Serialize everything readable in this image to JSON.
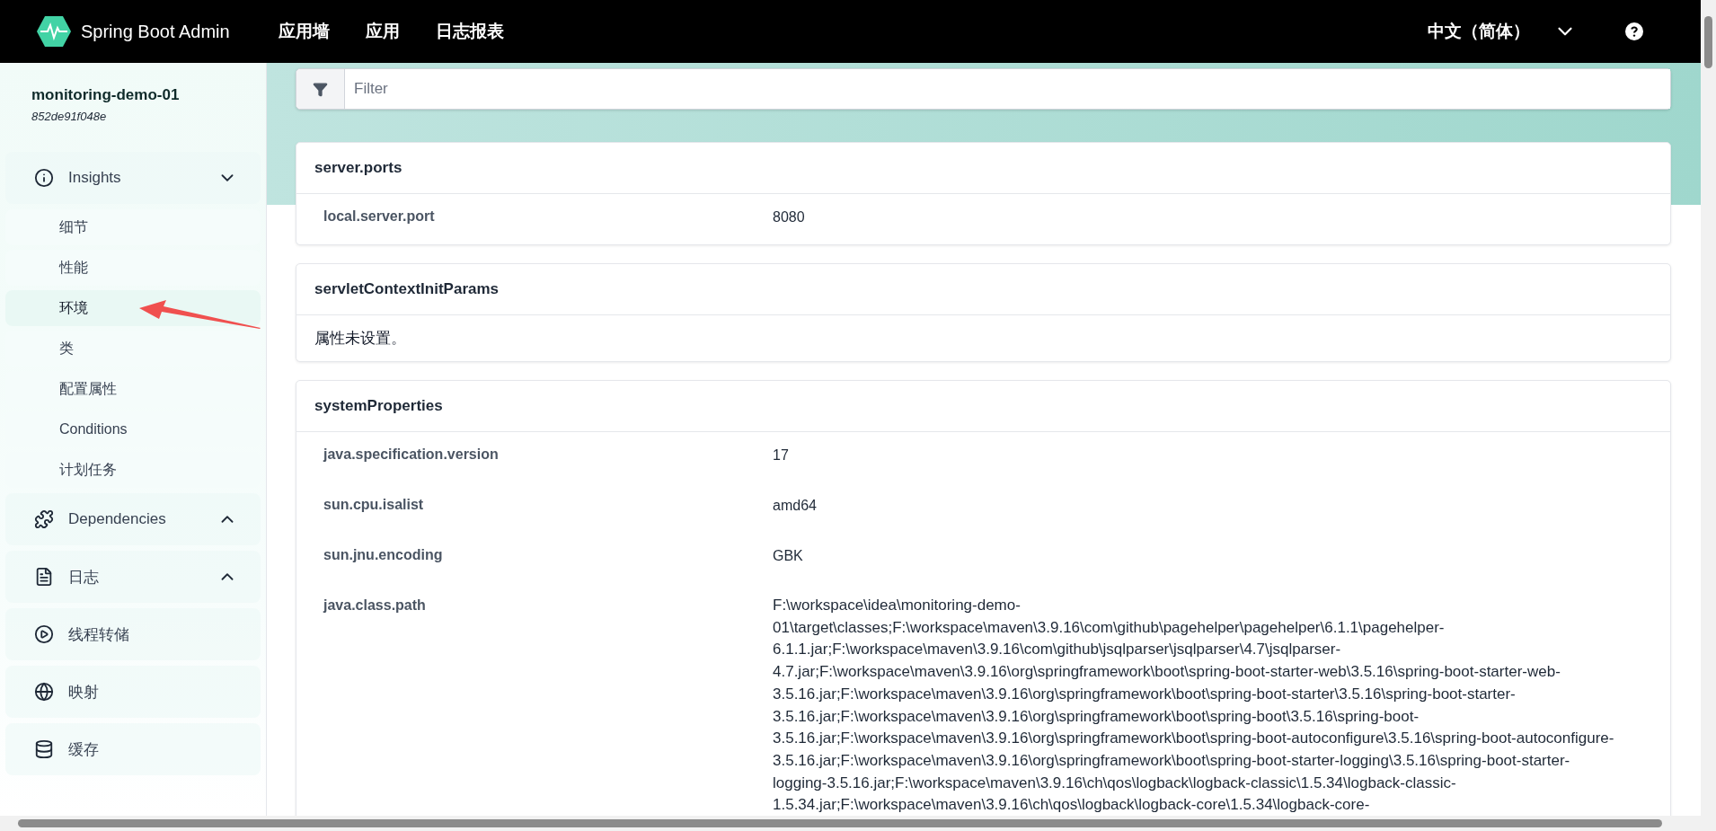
{
  "header": {
    "brand": "Spring Boot Admin",
    "nav": [
      "应用墙",
      "应用",
      "日志报表"
    ],
    "language": "中文（简体）"
  },
  "sidebar": {
    "app_name": "monitoring-demo-01",
    "instance_id": "852de91f048e",
    "items": [
      {
        "kind": "group",
        "label": "Insights",
        "expanded": true,
        "children": [
          {
            "label": "细节",
            "selected": false
          },
          {
            "label": "性能",
            "selected": false
          },
          {
            "label": "环境",
            "selected": true
          },
          {
            "label": "类",
            "selected": false
          },
          {
            "label": "配置属性",
            "selected": false
          },
          {
            "label": "Conditions",
            "selected": false
          },
          {
            "label": "计划任务",
            "selected": false
          }
        ]
      },
      {
        "kind": "group",
        "label": "Dependencies",
        "expanded": false
      },
      {
        "kind": "group",
        "label": "日志",
        "expanded": false
      },
      {
        "kind": "link",
        "label": "线程转储"
      },
      {
        "kind": "link",
        "label": "映射"
      },
      {
        "kind": "link",
        "label": "缓存"
      }
    ]
  },
  "filter": {
    "placeholder": "Filter"
  },
  "property_sources": [
    {
      "kind": "table",
      "name": "server.ports",
      "properties": [
        {
          "name": "local.server.port",
          "value": "8080"
        }
      ]
    },
    {
      "kind": "empty",
      "name": "servletContextInitParams",
      "message": "属性未设置。"
    },
    {
      "kind": "table",
      "name": "systemProperties",
      "properties": [
        {
          "name": "java.specification.version",
          "value": "17"
        },
        {
          "name": "sun.cpu.isalist",
          "value": "amd64"
        },
        {
          "name": "sun.jnu.encoding",
          "value": "GBK"
        },
        {
          "name": "java.class.path",
          "value_lines": [
            "F:\\workspace\\idea\\monitoring-demo-",
            "01\\target\\classes;F:\\workspace\\maven\\3.9.16\\com\\github\\pagehelper\\pagehelper\\6.1.1\\pagehelper-",
            "6.1.1.jar;F:\\workspace\\maven\\3.9.16\\com\\github\\jsqlparser\\jsqlparser\\4.7\\jsqlparser-",
            "4.7.jar;F:\\workspace\\maven\\3.9.16\\org\\springframework\\boot\\spring-boot-starter-web\\3.5.16\\spring-boot-starter-web-",
            "3.5.16.jar;F:\\workspace\\maven\\3.9.16\\org\\springframework\\boot\\spring-boot-starter\\3.5.16\\spring-boot-starter-",
            "3.5.16.jar;F:\\workspace\\maven\\3.9.16\\org\\springframework\\boot\\spring-boot\\3.5.16\\spring-boot-",
            "3.5.16.jar;F:\\workspace\\maven\\3.9.16\\org\\springframework\\boot\\spring-boot-autoconfigure\\3.5.16\\spring-boot-autoconfigure-",
            "3.5.16.jar;F:\\workspace\\maven\\3.9.16\\org\\springframework\\boot\\spring-boot-starter-logging\\3.5.16\\spring-boot-starter-",
            "logging-3.5.16.jar;F:\\workspace\\maven\\3.9.16\\ch\\qos\\logback\\logback-classic\\1.5.34\\logback-classic-",
            "1.5.34.jar;F:\\workspace\\maven\\3.9.16\\ch\\qos\\logback\\logback-core\\1.5.34\\logback-core-"
          ]
        }
      ]
    }
  ]
}
